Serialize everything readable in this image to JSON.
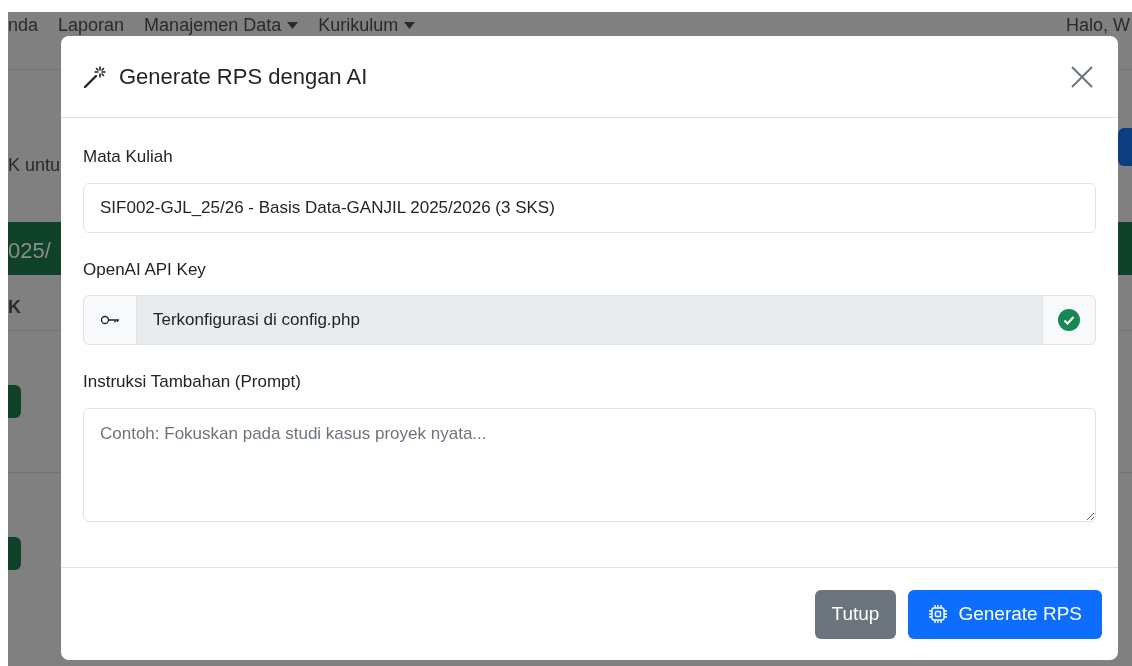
{
  "background": {
    "nav_items": [
      {
        "label": "nda",
        "dropdown": false
      },
      {
        "label": "Laporan",
        "dropdown": false
      },
      {
        "label": "Manajemen Data",
        "dropdown": true
      },
      {
        "label": "Kurikulum",
        "dropdown": true
      }
    ],
    "greeting": "Halo, W",
    "intro_fragment": "K untu",
    "banner_fragment": "025/",
    "column_fragment": "K"
  },
  "modal": {
    "title": "Generate RPS dengan AI",
    "fields": [
      {
        "kind": "input",
        "label": "Mata Kuliah",
        "value": "SIF002-GJL_25/26 - Basis Data-GANJIL 2025/2026 (3 SKS)"
      },
      {
        "kind": "key",
        "label": "OpenAI API Key",
        "value": "Terkonfigurasi di config.php",
        "verified": true
      },
      {
        "kind": "textarea",
        "label": "Instruksi Tambahan (Prompt)",
        "placeholder": "Contoh: Fokuskan pada studi kasus proyek nyata..."
      }
    ],
    "buttons": [
      {
        "label": "Tutup",
        "kind": "secondary"
      },
      {
        "label": "Generate RPS",
        "kind": "primary"
      }
    ]
  }
}
